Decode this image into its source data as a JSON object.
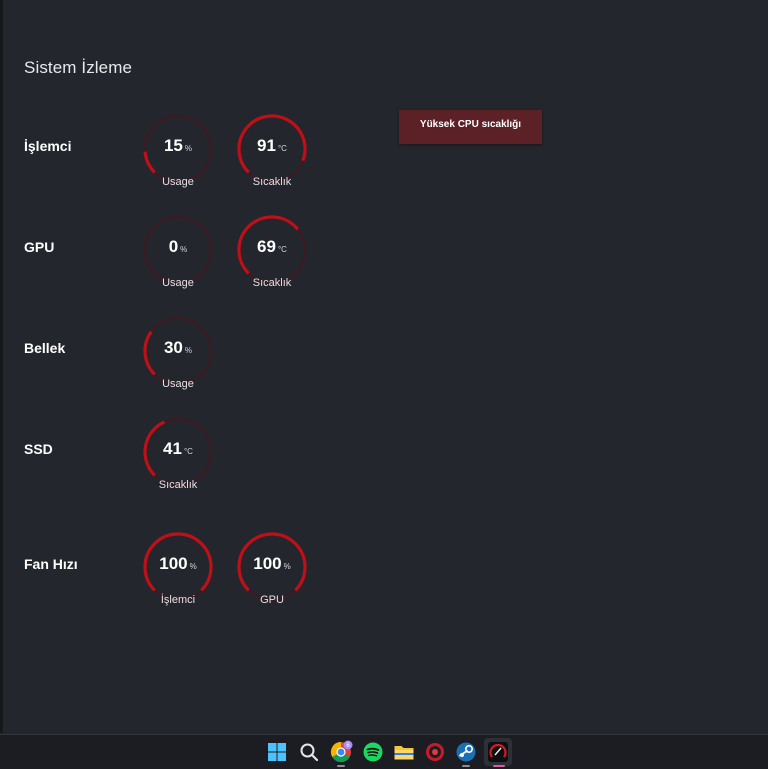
{
  "page_title": "Sistem İzleme",
  "alert": {
    "text": "Yüksek CPU sıcaklığı",
    "color": "#5b2127"
  },
  "colors": {
    "arc": "#c00f16",
    "track": "#3e1a20",
    "background": "#24262d"
  },
  "rows": {
    "cpu": {
      "label": "İşlemci",
      "usage": {
        "value": "15",
        "unit": "%",
        "caption": "Usage",
        "level": 0.15
      },
      "temp": {
        "value": "91",
        "unit": "°C",
        "caption": "Sıcaklık",
        "level": 0.91
      }
    },
    "gpu": {
      "label": "GPU",
      "usage": {
        "value": "0",
        "unit": "%",
        "caption": "Usage",
        "level": 0.0
      },
      "temp": {
        "value": "69",
        "unit": "°C",
        "caption": "Sıcaklık",
        "level": 0.69
      }
    },
    "memory": {
      "label": "Bellek",
      "usage": {
        "value": "30",
        "unit": "%",
        "caption": "Usage",
        "level": 0.3
      }
    },
    "ssd": {
      "label": "SSD",
      "temp": {
        "value": "41",
        "unit": "°C",
        "caption": "Sıcaklık",
        "level": 0.41
      }
    },
    "fan": {
      "label": "Fan Hızı",
      "cpu": {
        "value": "100",
        "unit": "%",
        "caption": "İşlemci",
        "level": 1.0
      },
      "gpu": {
        "value": "100",
        "unit": "%",
        "caption": "GPU",
        "level": 1.0
      }
    }
  },
  "taskbar": {
    "icons": [
      "windows-start-icon",
      "search-icon",
      "chrome-icon",
      "spotify-icon",
      "file-explorer-icon",
      "app-red-icon",
      "steam-icon",
      "monitor-app-icon"
    ],
    "chrome_badge": "6"
  }
}
